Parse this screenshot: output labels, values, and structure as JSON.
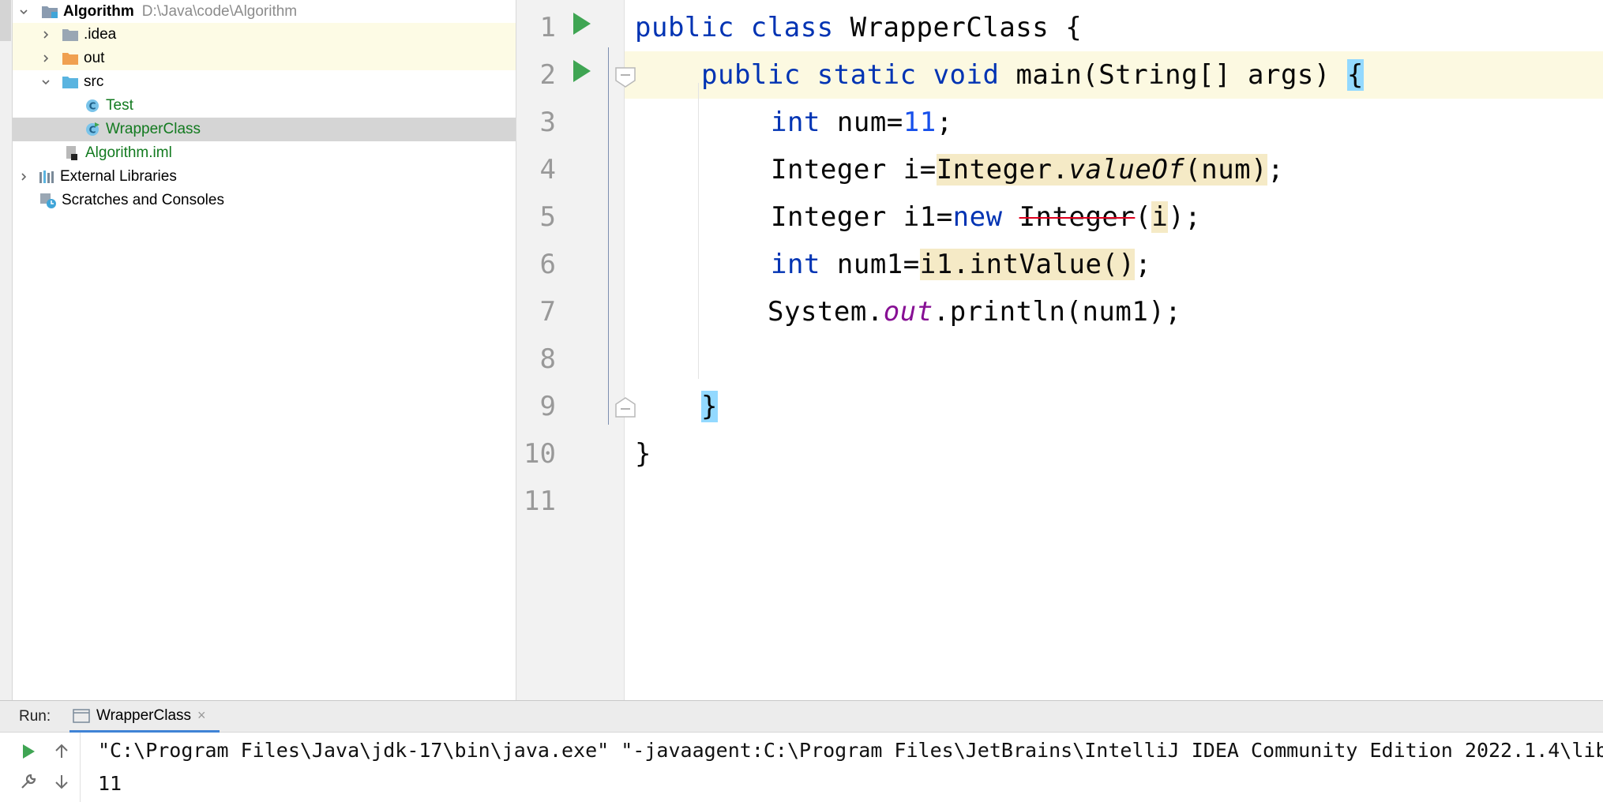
{
  "project_tree": {
    "root": {
      "label": "Algorithm",
      "path": "D:\\Java\\code\\Algorithm"
    },
    "items": [
      {
        "label": ".idea"
      },
      {
        "label": "out"
      },
      {
        "label": "src"
      },
      {
        "label": "Test"
      },
      {
        "label": "WrapperClass"
      },
      {
        "label": "Algorithm.iml"
      },
      {
        "label": "External Libraries"
      },
      {
        "label": "Scratches and Consoles"
      }
    ]
  },
  "editor": {
    "line_numbers": [
      "1",
      "2",
      "3",
      "4",
      "5",
      "6",
      "7",
      "8",
      "9",
      "10",
      "11"
    ],
    "lines": {
      "l1": {
        "kw": "public class ",
        "name": "WrapperClass {"
      },
      "l2": {
        "kw": "public static void ",
        "sig": "main(String[] args) ",
        "brace": "{"
      },
      "l3": {
        "kw": "int ",
        "a": "num=",
        "n": "11",
        "b": ";"
      },
      "l4": {
        "a": "Integer i=",
        "h1": "Integer.",
        "h2": "valueOf",
        "h3": "(num)",
        "b": ";"
      },
      "l5": {
        "a": "Integer i1=",
        "kw": "new ",
        "dep": "Integer",
        "p1": "(",
        "hi": "i",
        "p2": ");"
      },
      "l6": {
        "kw": "int ",
        "a": "num1=",
        "h": "i1.intValue()",
        "b": ";"
      },
      "l7": {
        "a": "System.",
        "f": "out",
        "b": ".println(num1);"
      },
      "l9": {
        "brace": "}"
      },
      "l10": {
        "brace": "}"
      }
    }
  },
  "run_panel": {
    "title": "Run:",
    "tab_label": "WrapperClass",
    "tab_close": "×",
    "console_lines": [
      "\"C:\\Program Files\\Java\\jdk-17\\bin\\java.exe\" \"-javaagent:C:\\Program Files\\JetBrains\\IntelliJ IDEA Community Edition 2022.1.4\\lib",
      "11"
    ]
  },
  "colors": {
    "keyword": "#0033b3",
    "number": "#1750eb",
    "field": "#871094",
    "run_green": "#3fa553",
    "tree_green": "#127a1f"
  }
}
